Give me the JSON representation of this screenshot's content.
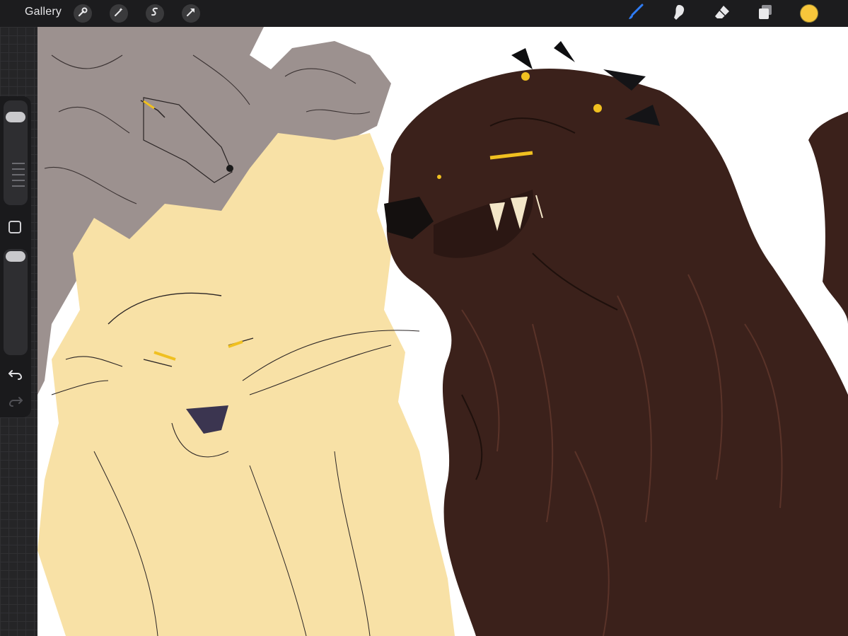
{
  "toolbar": {
    "gallery_label": "Gallery",
    "left_tools": [
      "wrench-icon",
      "magic-wand-icon",
      "selection-icon",
      "transform-arrow-icon"
    ],
    "right_tools": [
      "brush-icon",
      "smudge-icon",
      "eraser-icon",
      "layers-icon"
    ],
    "active_tool": "brush-icon",
    "current_color": "#f7c63b",
    "active_tool_color": "#2f7cf6"
  },
  "sidebar": {
    "brush_size_level": 0.1,
    "opacity_level": 0.0
  },
  "colors": {
    "canvas": "#ffffff",
    "gray_wolf": "#9c918f",
    "lion": "#f8e1a6",
    "brown_wolf": "#3b211b",
    "eye": "#f0c020"
  }
}
